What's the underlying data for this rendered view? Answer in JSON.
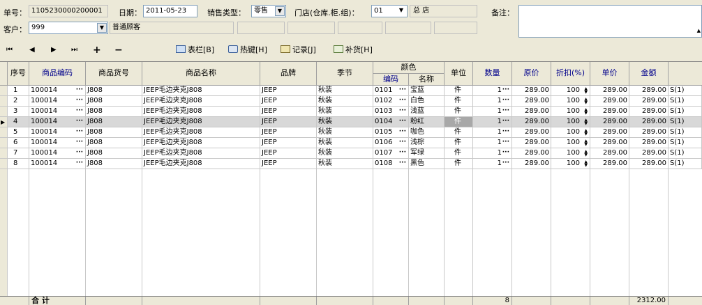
{
  "header": {
    "order_no_label": "单号：",
    "order_no": "1105230000200001",
    "date_label": "日期：",
    "date": "2011-05-23",
    "sale_type_label": "销售类型：",
    "sale_type": "零售",
    "store_label": "门店(仓库.柜.组)：",
    "store_code": "01",
    "store_name": "总  店",
    "remark_label": "备注：",
    "customer_label": "客户：",
    "customer_code": "999",
    "customer_name": "普通顾客"
  },
  "toolbar": {
    "nav_first": "⏮",
    "nav_prev": "◀",
    "nav_next": "▶",
    "nav_last": "⏭",
    "add": "+",
    "remove": "−",
    "columns": "表栏[B]",
    "hotkey": "热键[H]",
    "record": "记录[J]",
    "restock": "补货[H]"
  },
  "columns": {
    "seq": "序号",
    "item_code": "商品编码",
    "item_no": "商品货号",
    "item_name": "商品名称",
    "brand": "品牌",
    "season": "季节",
    "color": "颜色",
    "color_code": "编码",
    "color_name": "名称",
    "unit": "单位",
    "qty": "数量",
    "price": "原价",
    "discount": "折扣(%)",
    "unit_price": "单价",
    "amount": "金额"
  },
  "rows": [
    {
      "seq": "1",
      "code": "100014",
      "no": "J808",
      "name": "JEEP毛边夹克J808",
      "brand": "JEEP",
      "season": "秋装",
      "ccode": "0101",
      "cname": "宝蓝",
      "unit": "件",
      "qty": "1",
      "price": "289.00",
      "disc": "100",
      "uprice": "289.00",
      "amt": "289.00",
      "size": "S(1)"
    },
    {
      "seq": "2",
      "code": "100014",
      "no": "J808",
      "name": "JEEP毛边夹克J808",
      "brand": "JEEP",
      "season": "秋装",
      "ccode": "0102",
      "cname": "白色",
      "unit": "件",
      "qty": "1",
      "price": "289.00",
      "disc": "100",
      "uprice": "289.00",
      "amt": "289.00",
      "size": "S(1)"
    },
    {
      "seq": "3",
      "code": "100014",
      "no": "J808",
      "name": "JEEP毛边夹克J808",
      "brand": "JEEP",
      "season": "秋装",
      "ccode": "0103",
      "cname": "浅蓝",
      "unit": "件",
      "qty": "1",
      "price": "289.00",
      "disc": "100",
      "uprice": "289.00",
      "amt": "289.00",
      "size": "S(1)"
    },
    {
      "seq": "4",
      "code": "100014",
      "no": "J808",
      "name": "JEEP毛边夹克J808",
      "brand": "JEEP",
      "season": "秋装",
      "ccode": "0104",
      "cname": "粉红",
      "unit": "件",
      "qty": "1",
      "price": "289.00",
      "disc": "100",
      "uprice": "289.00",
      "amt": "289.00",
      "size": "S(1)"
    },
    {
      "seq": "5",
      "code": "100014",
      "no": "J808",
      "name": "JEEP毛边夹克J808",
      "brand": "JEEP",
      "season": "秋装",
      "ccode": "0105",
      "cname": "咖色",
      "unit": "件",
      "qty": "1",
      "price": "289.00",
      "disc": "100",
      "uprice": "289.00",
      "amt": "289.00",
      "size": "S(1)"
    },
    {
      "seq": "6",
      "code": "100014",
      "no": "J808",
      "name": "JEEP毛边夹克J808",
      "brand": "JEEP",
      "season": "秋装",
      "ccode": "0106",
      "cname": "浅棕",
      "unit": "件",
      "qty": "1",
      "price": "289.00",
      "disc": "100",
      "uprice": "289.00",
      "amt": "289.00",
      "size": "S(1)"
    },
    {
      "seq": "7",
      "code": "100014",
      "no": "J808",
      "name": "JEEP毛边夹克J808",
      "brand": "JEEP",
      "season": "秋装",
      "ccode": "0107",
      "cname": "军绿",
      "unit": "件",
      "qty": "1",
      "price": "289.00",
      "disc": "100",
      "uprice": "289.00",
      "amt": "289.00",
      "size": "S(1)"
    },
    {
      "seq": "8",
      "code": "100014",
      "no": "J808",
      "name": "JEEP毛边夹克J808",
      "brand": "JEEP",
      "season": "秋装",
      "ccode": "0108",
      "cname": "黑色",
      "unit": "件",
      "qty": "1",
      "price": "289.00",
      "disc": "100",
      "uprice": "289.00",
      "amt": "289.00",
      "size": "S(1)"
    }
  ],
  "selected_row": 4,
  "footer": {
    "total_label": "合  计",
    "total_qty": "8",
    "total_amount": "2312.00"
  },
  "colors": {
    "background": "#ece9d8",
    "header_blue": "#00008b",
    "field_border": "#7f9db9"
  }
}
